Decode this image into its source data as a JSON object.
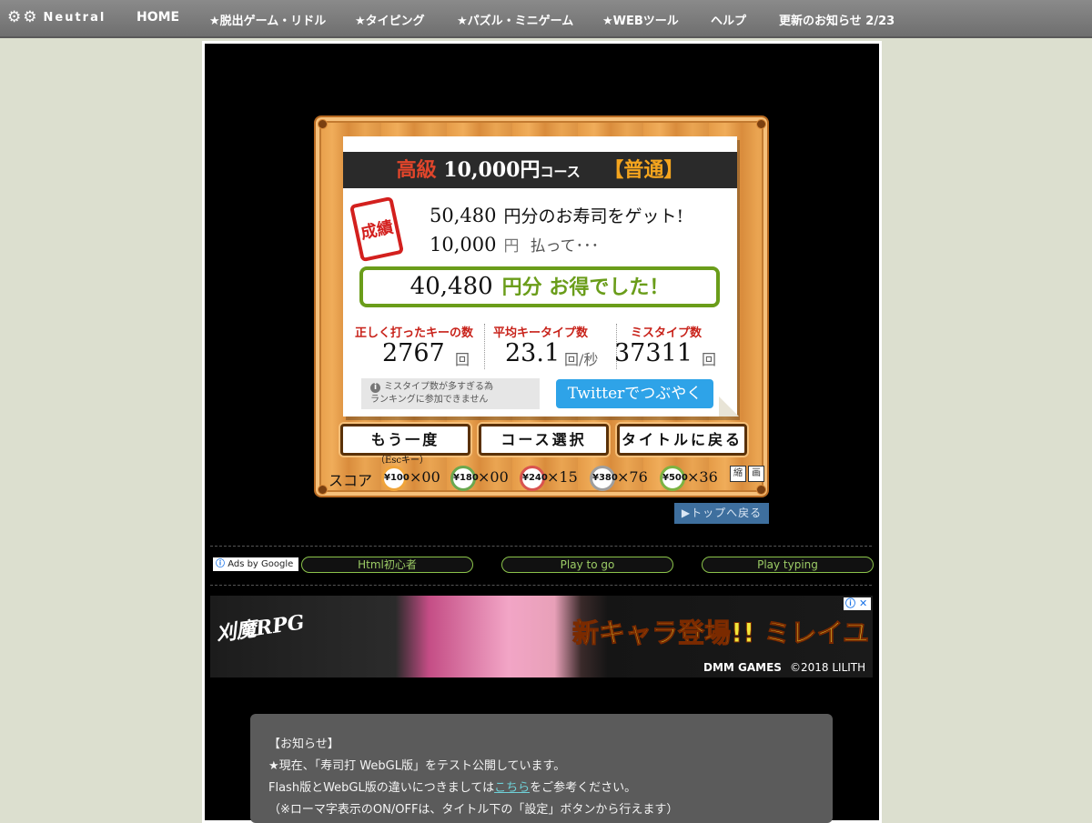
{
  "nav": {
    "logo_text": "Neutral",
    "items": [
      "HOME",
      "★脱出ゲーム・リドル",
      "★タイピング",
      "★パズル・ミニゲーム",
      "★WEBツール",
      "ヘルプ"
    ],
    "updates_label": "更新のお知らせ",
    "updates_date": "2/23"
  },
  "result": {
    "course_kou": "高級",
    "course_amount": "10,000円",
    "course_unit": "コース",
    "course_level": "【普通】",
    "stamp": "成績",
    "sushi_amount": "50,480",
    "sushi_text": "円分のお寿司をゲット!",
    "paid_amount": "10,000",
    "paid_yen": "円",
    "paid_text": "払って･･･",
    "profit_amount": "40,480",
    "profit_text": "円分 お得でした！",
    "stats": [
      {
        "label": "正しく打ったキーの数",
        "value": "2767",
        "unit": "回"
      },
      {
        "label": "平均キータイプ数",
        "value": "23.1",
        "unit": "回/秒"
      },
      {
        "label": "ミスタイプ数",
        "value": "37311",
        "unit": "回"
      }
    ],
    "warning": [
      "ミスタイプ数が多すぎる為",
      "ランキングに参加できません"
    ],
    "twitter_button": "Twitterでつぶやく",
    "buttons": [
      "もう一度",
      "コース選択",
      "タイトルに戻る"
    ],
    "esc_hint": "（Escキー）",
    "score_label": "スコア",
    "plates": [
      {
        "price": "¥100",
        "count": "×00",
        "color": "#f0a43a"
      },
      {
        "price": "¥180",
        "count": "×00",
        "color": "#6aa84f"
      },
      {
        "price": "¥240",
        "count": "×15",
        "color": "#d9534f"
      },
      {
        "price": "¥380",
        "count": "×76",
        "color": "#9e9e9e"
      },
      {
        "price": "¥500",
        "count": "×36",
        "color": "#7cb342"
      }
    ],
    "corner_icons": [
      "縮",
      "画"
    ]
  },
  "top_back": "▶トップへ戻る",
  "ads": {
    "ads_by": "Ads by Google",
    "links": [
      "Html初心者",
      "Play to go",
      "Play typing"
    ]
  },
  "banner": {
    "logo": "刈魔RPG",
    "headline": "新キャラ登場!! ミレイユ",
    "brand": "DMM GAMES",
    "copyright": "©2018 LILITH"
  },
  "notice": {
    "title": "【お知らせ】",
    "line1": "★現在、「寿司打 WebGL版」をテスト公開しています。",
    "line2_pre": "Flash版とWebGL版の違いにつきましては",
    "line2_link": "こちら",
    "line2_post": "をご参考ください。",
    "line3": "（※ローマ字表示のON/OFFは、タイトル下の「設定」ボタンから行えます）"
  }
}
